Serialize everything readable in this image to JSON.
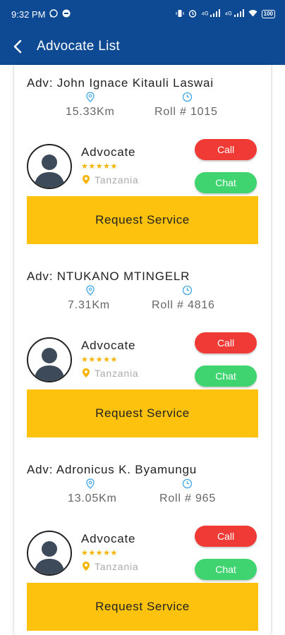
{
  "status_bar": {
    "time": "9:32 PM",
    "network_left": "⁴ᴳ",
    "network_right": "⁴ᴳ",
    "battery": "100"
  },
  "app_bar": {
    "title": "Advocate List"
  },
  "advocates": [
    {
      "name": "Adv: John Ignace Kitauli Laswai",
      "distance": "15.33Km",
      "roll": "Roll # 1015",
      "role": "Advocate",
      "stars": "★★★★★",
      "country": "Tanzania",
      "call_label": "Call",
      "chat_label": "Chat",
      "request_label": "Request Service"
    },
    {
      "name": "Adv: NTUKANO MTINGELR",
      "distance": "7.31Km",
      "roll": "Roll # 4816",
      "role": "Advocate",
      "stars": "★★★★★",
      "country": "Tanzania",
      "call_label": "Call",
      "chat_label": "Chat",
      "request_label": "Request Service"
    },
    {
      "name": "Adv: Adronicus K. Byamungu",
      "distance": "13.05Km",
      "roll": "Roll # 965",
      "role": "Advocate",
      "stars": "★★★★★",
      "country": "Tanzania",
      "call_label": "Call",
      "chat_label": "Chat",
      "request_label": "Request Service"
    }
  ],
  "colors": {
    "primary": "#0d4a93",
    "call": "#ef3a35",
    "chat": "#3fd46f",
    "request": "#fdc20d",
    "star": "#f5b400",
    "icon_blue": "#3fa7e6"
  }
}
